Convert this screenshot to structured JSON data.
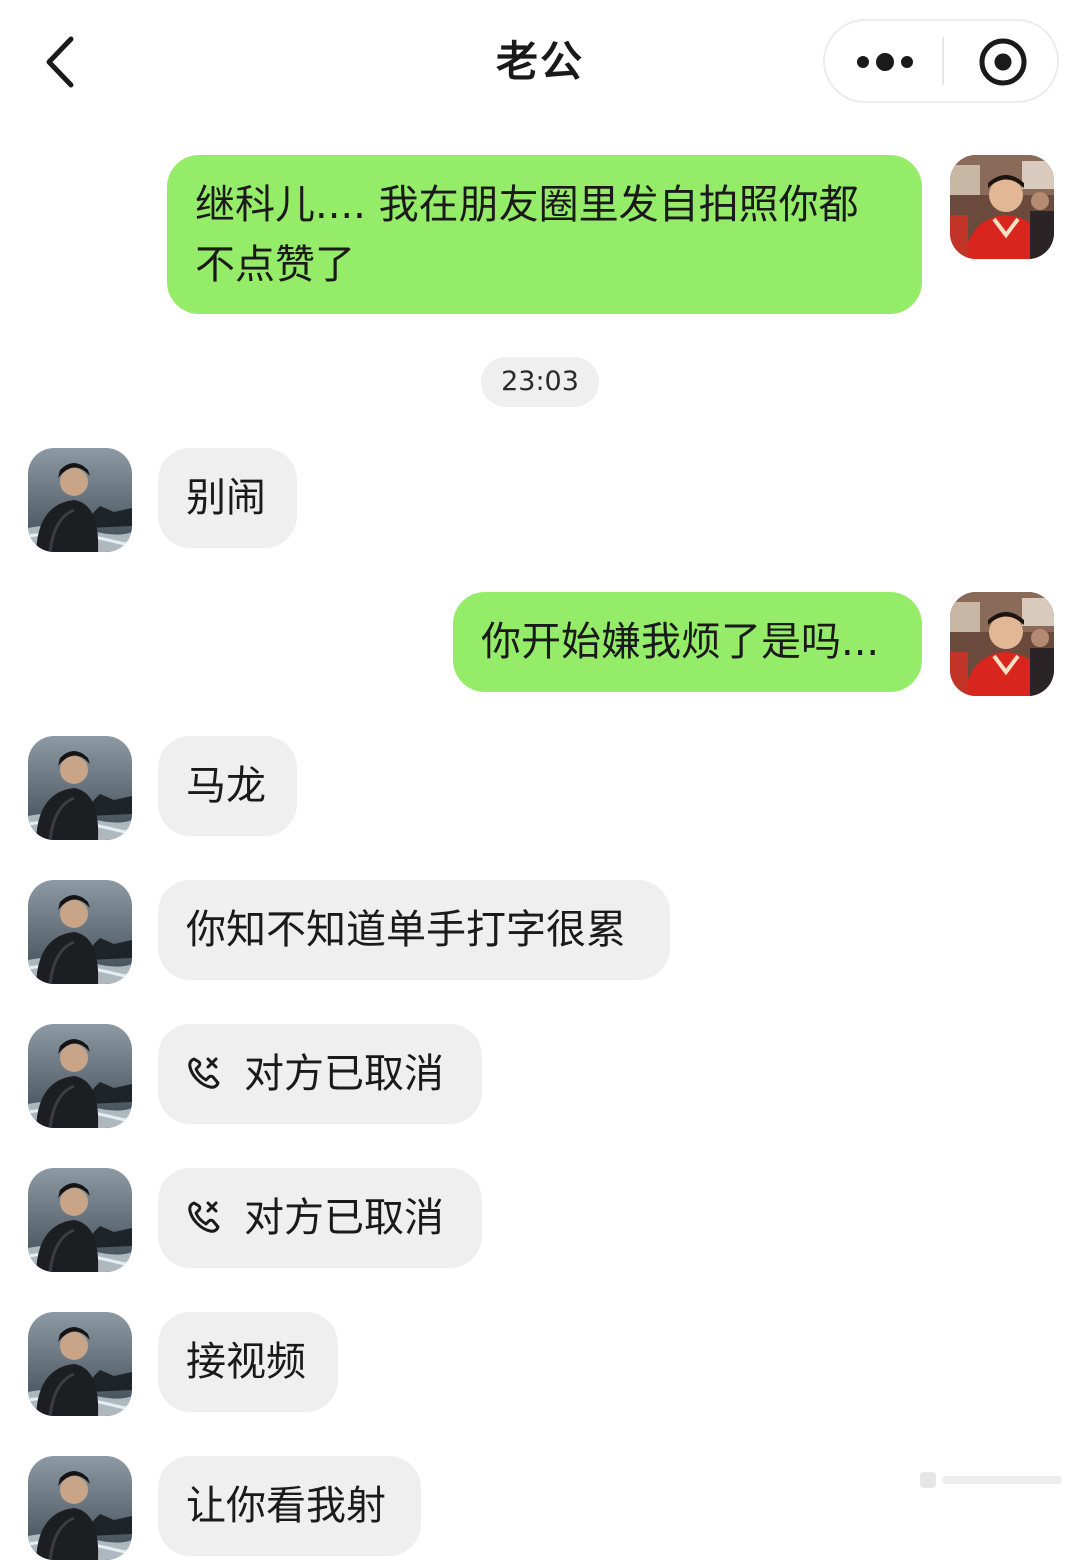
{
  "header": {
    "title": "老公",
    "back_icon": "chevron-left-icon",
    "more_icon": "more-dots-icon",
    "close_icon": "target-close-icon"
  },
  "messages": [
    {
      "from": "me",
      "text": "继科儿.... 我在朋友圈里发自拍照你都不点赞了"
    },
    {
      "type": "time",
      "text": "23:03"
    },
    {
      "from": "other",
      "text": "别闹"
    },
    {
      "from": "me",
      "text": "你开始嫌我烦了是吗..."
    },
    {
      "from": "other",
      "text": "马龙"
    },
    {
      "from": "other",
      "text": "你知不知道单手打字很累"
    },
    {
      "from": "other",
      "type": "call",
      "icon": "call-cancelled-icon",
      "text": "对方已取消"
    },
    {
      "from": "other",
      "type": "call",
      "icon": "call-cancelled-icon",
      "text": "对方已取消"
    },
    {
      "from": "other",
      "text": "接视频"
    },
    {
      "from": "other",
      "text": "让你看我射"
    }
  ],
  "colors": {
    "my_bubble": "#95ec69",
    "other_bubble": "#efefef",
    "background": "#ffffff"
  }
}
